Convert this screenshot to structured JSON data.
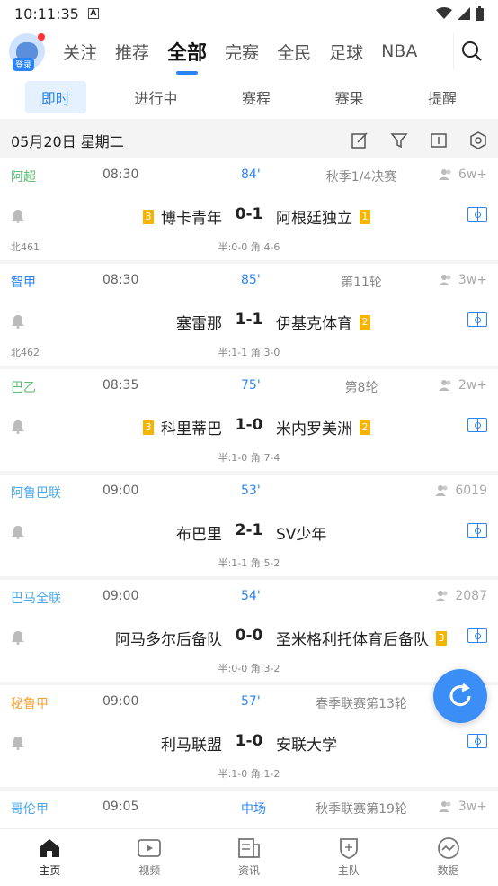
{
  "status": {
    "time": "10:11:35"
  },
  "topnav": {
    "login": "登录",
    "tabs": [
      {
        "label": "关注"
      },
      {
        "label": "推荐"
      },
      {
        "label": "全部",
        "active": true
      },
      {
        "label": "完赛"
      },
      {
        "label": "全民"
      },
      {
        "label": "足球"
      },
      {
        "label": "NBA"
      }
    ]
  },
  "subtabs": [
    {
      "label": "即时",
      "active": true
    },
    {
      "label": "进行中"
    },
    {
      "label": "赛程"
    },
    {
      "label": "赛果"
    },
    {
      "label": "提醒"
    }
  ],
  "date": "05月20日 星期二",
  "matches": [
    {
      "league": "阿超",
      "league_color": "#5bbd72",
      "time": "08:30",
      "minute": "84'",
      "round": "秋季1/4决赛",
      "people": "6w+",
      "home": "博卡青年",
      "home_badge": "3",
      "score": "0-1",
      "away": "阿根廷独立",
      "away_badge": "1",
      "code": "北461",
      "half": "半:0-0 角:4-6"
    },
    {
      "league": "智甲",
      "league_color": "#2b84f5",
      "time": "08:30",
      "minute": "85'",
      "round": "第11轮",
      "people": "3w+",
      "home": "塞雷那",
      "home_badge": "",
      "score": "1-1",
      "away": "伊基克体育",
      "away_badge": "2",
      "code": "北462",
      "half": "半:1-1 角:3-0"
    },
    {
      "league": "巴乙",
      "league_color": "#5bbd72",
      "time": "08:35",
      "minute": "75'",
      "round": "第8轮",
      "people": "2w+",
      "home": "科里蒂巴",
      "home_badge": "3",
      "score": "1-0",
      "away": "米内罗美洲",
      "away_badge": "2",
      "code": "",
      "half": "半:1-0 角:7-4"
    },
    {
      "league": "阿鲁巴联",
      "league_color": "#4aa8e8",
      "time": "09:00",
      "minute": "53'",
      "round": "",
      "people": "6019",
      "home": "布巴里",
      "home_badge": "",
      "score": "2-1",
      "away": "SV少年",
      "away_badge": "",
      "code": "",
      "half": "半:1-1 角:5-2"
    },
    {
      "league": "巴马全联",
      "league_color": "#4aa8e8",
      "time": "09:00",
      "minute": "54'",
      "round": "",
      "people": "2087",
      "home": "阿马多尔后备队",
      "home_badge": "",
      "score": "0-0",
      "away": "圣米格利托体育后备队",
      "away_badge": "3",
      "code": "",
      "half": "半:0-0 角:3-2"
    },
    {
      "league": "秘鲁甲",
      "league_color": "#f0a030",
      "time": "09:00",
      "minute": "57'",
      "round": "春季联赛第13轮",
      "people": "",
      "home": "利马联盟",
      "home_badge": "",
      "score": "1-0",
      "away": "安联大学",
      "away_badge": "",
      "code": "",
      "half": "半:1-0 角:1-2"
    },
    {
      "league": "哥伦甲",
      "league_color": "#4aa8e8",
      "time": "09:05",
      "minute": "中场",
      "round": "秋季联赛第19轮",
      "people": "3w+",
      "home": "",
      "home_badge": "",
      "score": "",
      "away": "",
      "away_badge": "",
      "code": "",
      "half": ""
    }
  ],
  "bottomnav": [
    {
      "label": "主页",
      "icon": "home-icon",
      "active": true
    },
    {
      "label": "视频",
      "icon": "video-icon"
    },
    {
      "label": "资讯",
      "icon": "news-icon"
    },
    {
      "label": "主队",
      "icon": "team-shield-icon"
    },
    {
      "label": "数据",
      "icon": "data-icon"
    }
  ]
}
